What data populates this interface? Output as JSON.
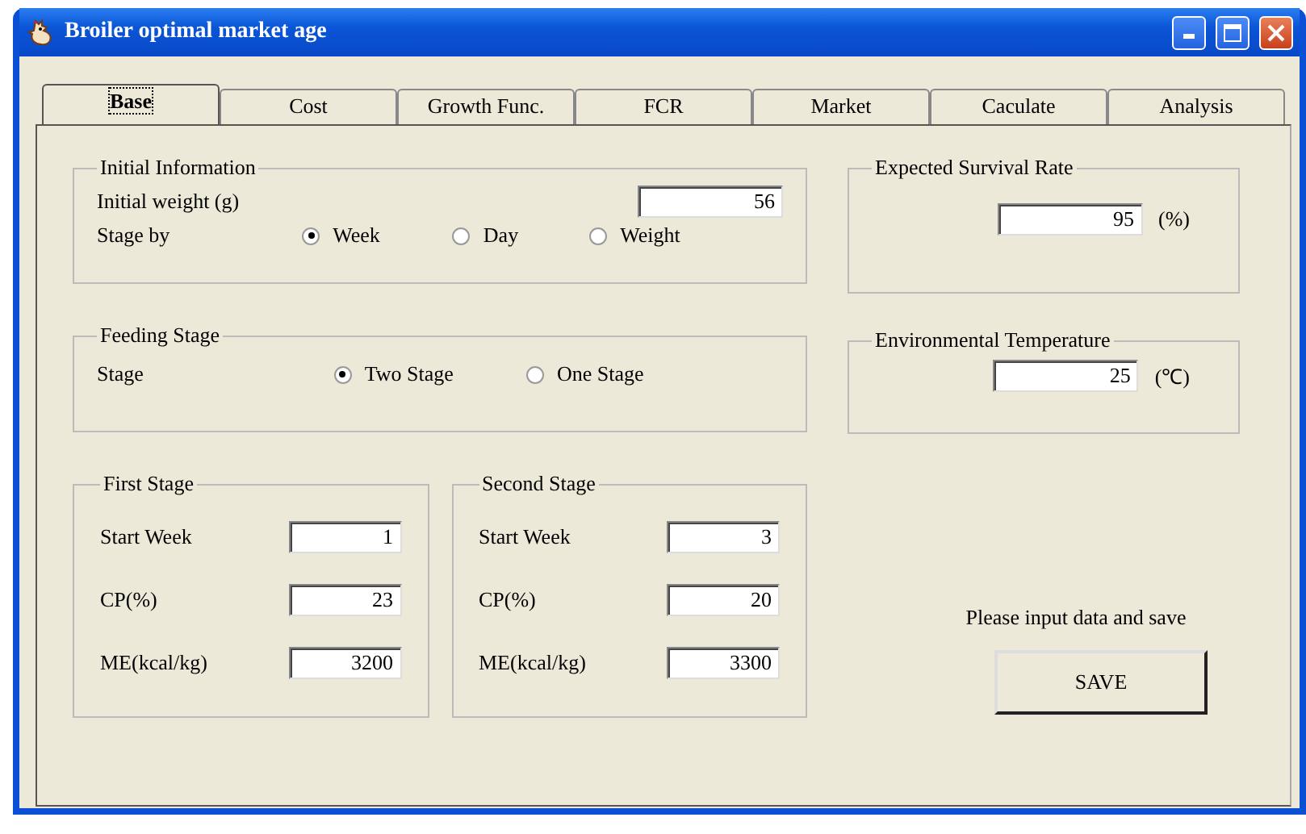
{
  "window": {
    "title": "Broiler optimal market age"
  },
  "tabs": [
    {
      "label": "Base",
      "selected": true
    },
    {
      "label": "Cost",
      "selected": false
    },
    {
      "label": "Growth Func.",
      "selected": false
    },
    {
      "label": "FCR",
      "selected": false
    },
    {
      "label": "Market",
      "selected": false
    },
    {
      "label": "Caculate",
      "selected": false
    },
    {
      "label": "Analysis",
      "selected": false
    }
  ],
  "initial_information": {
    "title": "Initial Information",
    "weight_label": "Initial weight (g)",
    "weight_value": "56",
    "stage_by_label": "Stage by",
    "options": [
      {
        "label": "Week",
        "selected": true
      },
      {
        "label": "Day",
        "selected": false
      },
      {
        "label": "Weight",
        "selected": false
      }
    ]
  },
  "feeding_stage": {
    "title": "Feeding Stage",
    "label": "Stage",
    "options": [
      {
        "label": "Two Stage",
        "selected": true
      },
      {
        "label": "One Stage",
        "selected": false
      }
    ]
  },
  "stages": [
    {
      "title": "First Stage",
      "fields": [
        {
          "label": "Start Week",
          "value": "1"
        },
        {
          "label": "CP(%)",
          "value": "23"
        },
        {
          "label": "ME(kcal/kg)",
          "value": "3200"
        }
      ]
    },
    {
      "title": "Second Stage",
      "fields": [
        {
          "label": "Start Week",
          "value": "3"
        },
        {
          "label": "CP(%)",
          "value": "20"
        },
        {
          "label": "ME(kcal/kg)",
          "value": "3300"
        }
      ]
    }
  ],
  "survival": {
    "title": "Expected Survival Rate",
    "value": "95",
    "unit": "(%)"
  },
  "temperature": {
    "title": "Environmental Temperature",
    "value": "25",
    "unit": "(℃)"
  },
  "hint": "Please input data and save",
  "save_button": "SAVE"
}
